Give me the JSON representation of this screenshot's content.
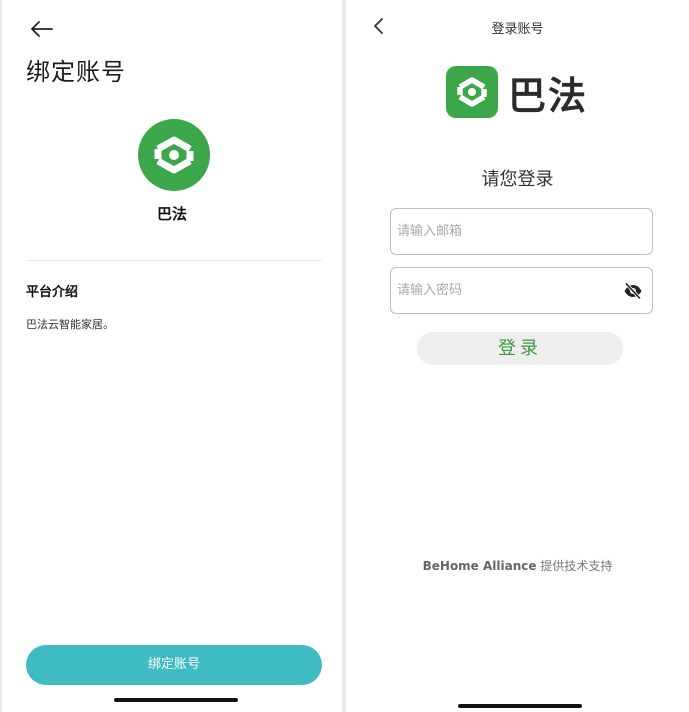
{
  "bind_screen": {
    "title": "绑定账号",
    "app_name": "巴法",
    "section_title": "平台介绍",
    "section_desc": "巴法云智能家居。",
    "bind_button_label": "绑定账号",
    "icons": {
      "back": "arrow-left-icon",
      "logo": "bafa-logo-icon"
    }
  },
  "login_screen": {
    "nav_title": "登录账号",
    "brand_name": "巴法",
    "heading": "请您登录",
    "email_placeholder": "请输入邮箱",
    "email_value": "",
    "password_placeholder": "请输入密码",
    "password_value": "",
    "login_button_label": "登录",
    "footer_brand": "BeHome Alliance",
    "footer_text": "提供技术支持",
    "icons": {
      "back": "chevron-left-icon",
      "logo": "bafa-logo-icon",
      "eye": "eye-off-icon"
    }
  },
  "colors": {
    "brand_green": "#3ba64a",
    "bind_button": "#3fbcc1",
    "login_text": "#3e9a3e",
    "login_button_bg": "#eeeeee"
  }
}
